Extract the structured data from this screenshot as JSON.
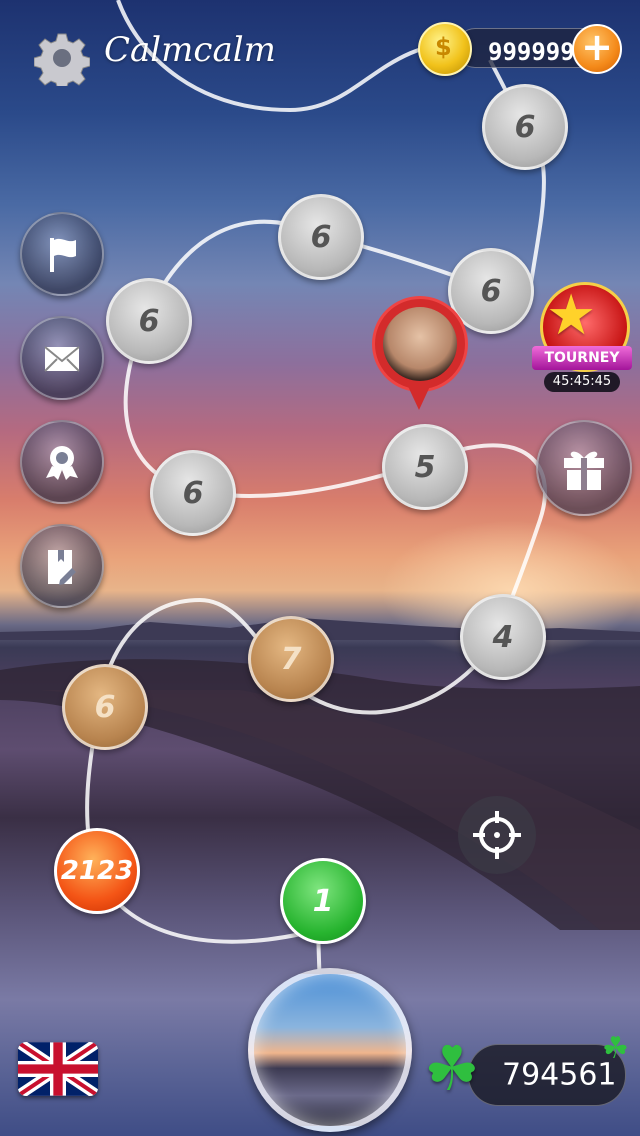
{
  "header": {
    "app_title": "Calmcalm",
    "coins": "999999",
    "add_label": "+"
  },
  "side_menu": [
    {
      "icon": "flag-icon"
    },
    {
      "icon": "mail-icon"
    },
    {
      "icon": "award-ribbon-icon"
    },
    {
      "icon": "edit-document-icon"
    }
  ],
  "map_nodes": [
    {
      "label": "6",
      "style": "gray"
    },
    {
      "label": "6",
      "style": "gray"
    },
    {
      "label": "6",
      "style": "gray"
    },
    {
      "label": "6",
      "style": "gray"
    },
    {
      "label": "6",
      "style": "gray"
    },
    {
      "label": "5",
      "style": "gray"
    },
    {
      "label": "4",
      "style": "gray"
    },
    {
      "label": "7",
      "style": "bronze"
    },
    {
      "label": "6",
      "style": "bronze"
    },
    {
      "label": "2123",
      "style": "orange"
    },
    {
      "label": "1",
      "style": "green"
    }
  ],
  "tourney": {
    "label": "TOURNEY",
    "timer": "45:45:45"
  },
  "clovers": {
    "count": "794561"
  },
  "colors": {
    "coin_add": "#f48a1a",
    "node_green": "#27b42f",
    "node_orange": "#f45516",
    "node_bronze": "#b8844f",
    "tourney_ribbon": "#d43fc8"
  },
  "language": {
    "icon": "uk-flag-icon"
  }
}
